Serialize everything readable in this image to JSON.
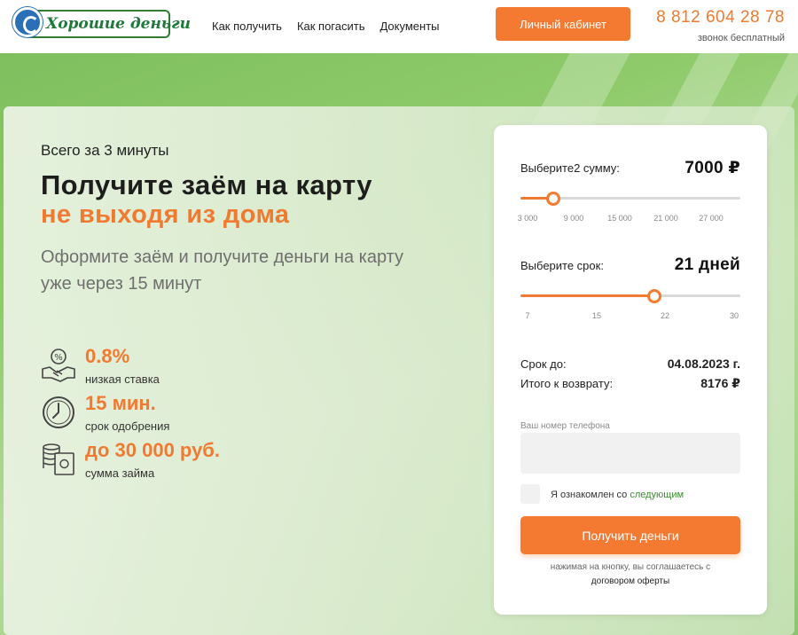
{
  "header": {
    "logo_text": "Хорошие деньги",
    "nav": [
      "Как получить",
      "Как погасить",
      "Документы"
    ],
    "cabinet_button": "Личный кабинет",
    "phone": "8 812 604 28 78",
    "phone_note": "звонок бесплатный"
  },
  "hero": {
    "pre_title": "Всего за 3 минуты",
    "title_line1": "Получите заём на карту",
    "title_line2": "не выходя из дома",
    "subtitle": "Оформите заём и получите деньги на карту уже через 15 минут",
    "features": [
      {
        "value": "0.8%",
        "caption": "низкая ставка",
        "icon": "handshake-percent-icon"
      },
      {
        "value": "15 мин.",
        "caption": "срок одобрения",
        "icon": "clock-icon"
      },
      {
        "value": "до 30 000 руб.",
        "caption": "сумма займа",
        "icon": "money-stack-icon"
      }
    ]
  },
  "form": {
    "amount_label": "Выберите2 сумму:",
    "amount_value": "7000 ₽",
    "amount_slider": {
      "min": 3000,
      "max": 30000,
      "value": 7000
    },
    "amount_ticks": [
      "3 000",
      "9 000",
      "15 000",
      "21 000",
      "27 000"
    ],
    "term_label": "Выберите срок:",
    "term_value": "21 дней",
    "term_slider": {
      "min": 7,
      "max": 30,
      "value": 21
    },
    "term_ticks": [
      "7",
      "15",
      "22",
      "30"
    ],
    "due_label": "Срок до:",
    "due_value": "04.08.2023 г.",
    "total_label": "Итого к возврату:",
    "total_value": "8176 ₽",
    "phone_label": "Ваш номер телефона",
    "phone_placeholder": "",
    "agree_text": "Я ознакомлен со",
    "agree_link": "следующим",
    "submit_label": "Получить деньги",
    "footnote_line1": "нажимая на кнопку, вы соглашаетесь с",
    "footnote_link": "договором оферты"
  },
  "colors": {
    "accent": "#f47a32",
    "brand_green": "#1e7a3a",
    "link_green": "#3b8d2f"
  }
}
